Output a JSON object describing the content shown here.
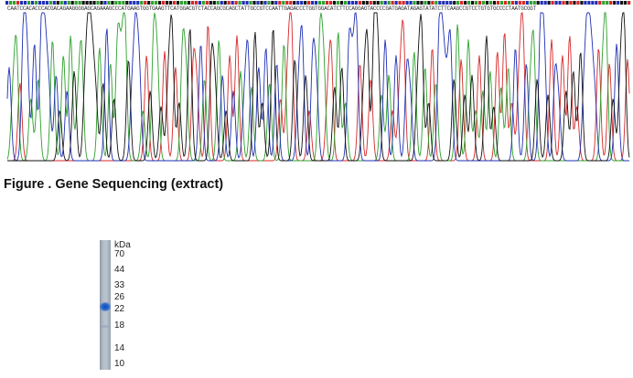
{
  "sequence": {
    "bases": "CAATCCACACCCACGACAGAAGGGGAGCAGAAAGCCCATGAAGTGGTGAAGTTCATGGACGTCTACCAGCGCAGCTATTGCCGTCCAATTGAGACCCTGGTGGACATCTTCCAGGAGTACCCCGATGAGATAGAGTATATCTTCAAGCCGTCCTGTGTGCCCCTAATGCGGT",
    "colors": {
      "A": "#2ca02c",
      "C": "#1f2fb4",
      "G": "#111111",
      "T": "#d62728"
    }
  },
  "figure": {
    "caption": "Figure . Gene Sequencing (extract)"
  },
  "gel": {
    "unit": "kDa",
    "markers": [
      "70",
      "44",
      "33",
      "26",
      "22",
      "18",
      "14",
      "10"
    ],
    "band_kda": "22"
  }
}
